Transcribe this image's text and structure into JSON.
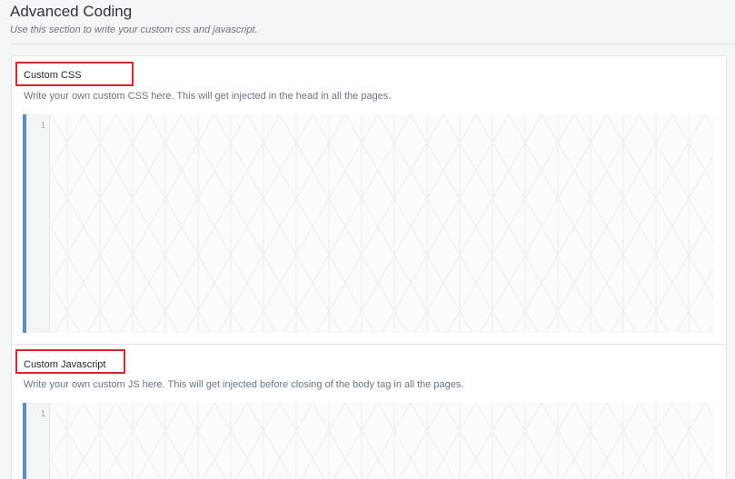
{
  "page": {
    "title": "Advanced Coding",
    "subtitle": "Use this section to write your custom css and javascript."
  },
  "sections": [
    {
      "label": "Custom CSS",
      "description": "Write your own custom CSS here. This will get injected in the head in all the pages.",
      "editor": {
        "line_number": "1",
        "value": ""
      }
    },
    {
      "label": "Custom Javascript",
      "description": "Write your own custom JS here. This will get injected before closing of the body tag in all the pages.",
      "editor": {
        "line_number": "1",
        "value": ""
      }
    }
  ],
  "colors": {
    "highlight_box": "#d7262e",
    "editor_bar": "#5b8ec1"
  }
}
